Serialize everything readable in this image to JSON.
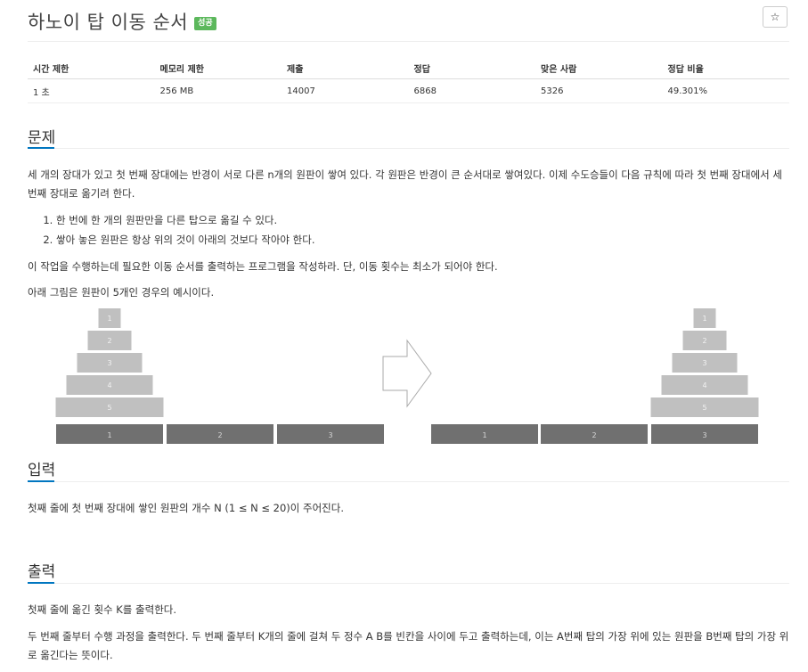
{
  "header": {
    "title": "하노이 탑 이동 순서",
    "badge": "성공",
    "star_icon": "☆"
  },
  "stats": {
    "headers": [
      "시간 제한",
      "메모리 제한",
      "제출",
      "정답",
      "맞은 사람",
      "정답 비율"
    ],
    "values": [
      "1 초",
      "256 MB",
      "14007",
      "6868",
      "5326",
      "49.301%"
    ]
  },
  "problem": {
    "title": "문제",
    "intro": "세 개의 장대가 있고 첫 번째 장대에는 반경이 서로 다른 n개의 원판이 쌓여 있다. 각 원판은 반경이 큰 순서대로 쌓여있다. 이제 수도승들이 다음 규칙에 따라 첫 번째 장대에서 세 번째 장대로 옮기려 한다.",
    "rules": [
      "한 번에 한 개의 원판만을 다른 탑으로 옮길 수 있다.",
      "쌓아 놓은 원판은 항상 위의 것이 아래의 것보다 작아야 한다."
    ],
    "task": "이 작업을 수행하는데 필요한 이동 순서를 출력하는 프로그램을 작성하라. 단, 이동 횟수는 최소가 되어야 한다.",
    "figure_caption": "아래 그림은 원판이 5개인 경우의 예시이다."
  },
  "figure": {
    "disk_labels": [
      "1",
      "2",
      "3",
      "4",
      "5"
    ],
    "peg_labels": [
      "1",
      "2",
      "3"
    ],
    "disk_color": "#c0c0c0",
    "base_color": "#707070",
    "arrow_icon": "right-arrow"
  },
  "input": {
    "title": "입력",
    "text": "첫째 줄에 첫 번째 장대에 쌓인 원판의 개수 N (1 ≤ N ≤ 20)이 주어진다."
  },
  "output": {
    "title": "출력",
    "line1": "첫째 줄에 옮긴 횟수 K를 출력한다.",
    "line2": "두 번째 줄부터 수행 과정을 출력한다. 두 번째 줄부터 K개의 줄에 걸쳐 두 정수 A B를 빈칸을 사이에 두고 출력하는데, 이는 A번째 탑의 가장 위에 있는 원판을 B번째 탑의 가장 위로 옮긴다는 뜻이다."
  },
  "colors": {
    "accent": "#0076c0",
    "badge": "#5cb85c"
  }
}
